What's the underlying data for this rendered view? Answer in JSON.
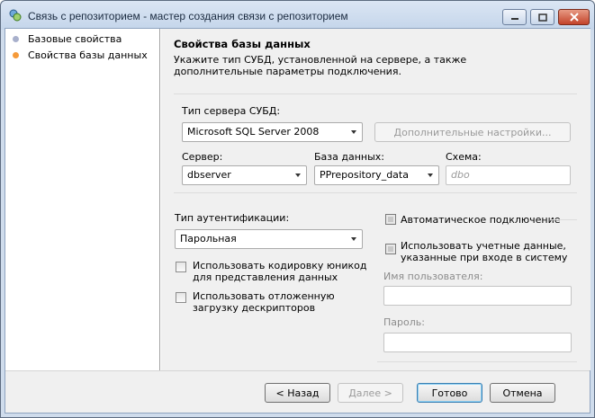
{
  "window": {
    "title": "Связь с репозиторием - мастер создания связи с репозиторием"
  },
  "steps": [
    {
      "label": "Базовые свойства",
      "color": "#a8b0cc"
    },
    {
      "label": "Свойства базы данных",
      "color": "#f59a3a"
    }
  ],
  "page": {
    "title": "Свойства базы данных",
    "description": "Укажите тип СУБД, установленной на сервере, а также дополнительные параметры подключения."
  },
  "dbms": {
    "label": "Тип сервера СУБД:",
    "value": "Microsoft SQL Server 2008",
    "extra_settings_label": "Дополнительные настройки..."
  },
  "server": {
    "label": "Сервер:",
    "value": "dbserver"
  },
  "database": {
    "label": "База данных:",
    "value": "PPrepository_data"
  },
  "schema": {
    "label": "Схема:",
    "placeholder": "dbo"
  },
  "auth": {
    "label": "Тип аутентификации:",
    "value": "Парольная",
    "unicode_label": "Использовать кодировку юникод для представления данных",
    "deferred_label": "Использовать отложенную загрузку дескрипторов",
    "auto_connect_label": "Автоматическое подключение",
    "use_credentials_label": "Использовать учетные данные, указанные при входе в систему",
    "username_label": "Имя пользователя:",
    "password_label": "Пароль:"
  },
  "buttons": {
    "back": "< Назад",
    "next": "Далее >",
    "finish": "Готово",
    "cancel": "Отмена"
  }
}
